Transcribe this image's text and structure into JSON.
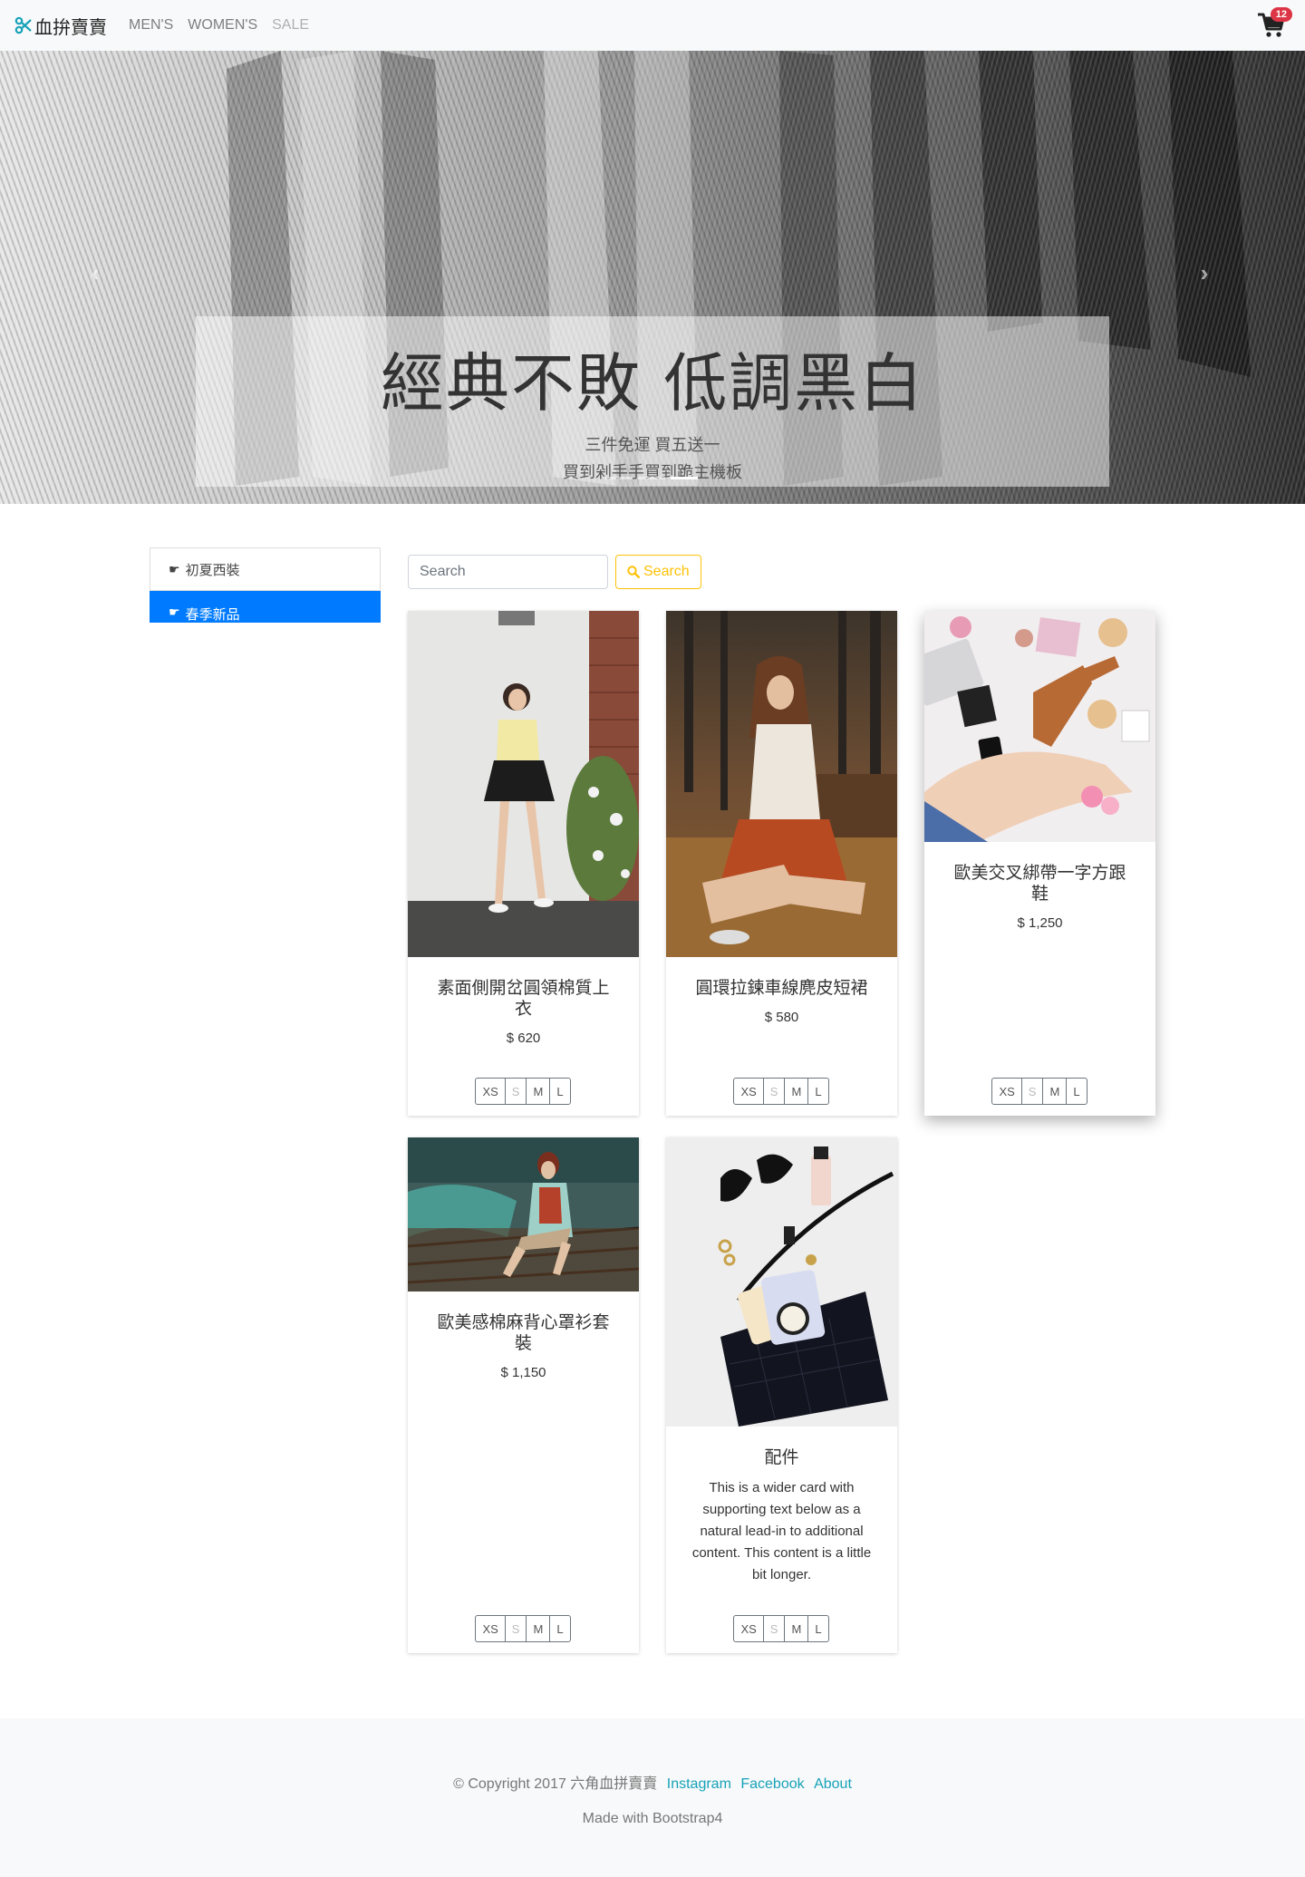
{
  "navbar": {
    "brand": "血拚賣賣",
    "links": [
      "MEN'S",
      "WOMEN'S",
      "SALE"
    ],
    "cart_count": "12"
  },
  "carousel": {
    "title": "經典不敗 低調黑白",
    "line1": "三件免運 買五送一",
    "line2": "買到剁手手買到跪主機板",
    "prev_icon": "chevron-left-icon",
    "next_icon": "chevron-right-icon"
  },
  "sidebar": {
    "items": [
      {
        "label": "初夏西裝"
      },
      {
        "label": "春季新品"
      }
    ]
  },
  "search": {
    "placeholder": "Search",
    "button_label": "Search"
  },
  "products": [
    {
      "title": "素面側開岔圓領棉質上衣",
      "price": "$ 620"
    },
    {
      "title": "圓環拉鍊車線麂皮短裙",
      "price": "$ 580"
    },
    {
      "title": "歐美交叉綁帶一字方跟鞋",
      "price": "$ 1,250"
    },
    {
      "title": "歐美感棉麻背心罩衫套裝",
      "price": "$ 1,150"
    },
    {
      "title": "配件",
      "text": "This is a wider card with supporting text below as a natural lead-in to additional content. This content is a little bit longer."
    }
  ],
  "sizes": [
    "XS",
    "S",
    "M",
    "L"
  ],
  "footer": {
    "copyright": "© Copyright 2017 六角血拼賣賣",
    "links": [
      "Instagram",
      "Facebook",
      "About"
    ],
    "made_with": "Made with Bootstrap4"
  },
  "colors": {
    "primary": "#007bff",
    "warning": "#ffc107",
    "info": "#17a2b8",
    "danger": "#dc3545"
  }
}
